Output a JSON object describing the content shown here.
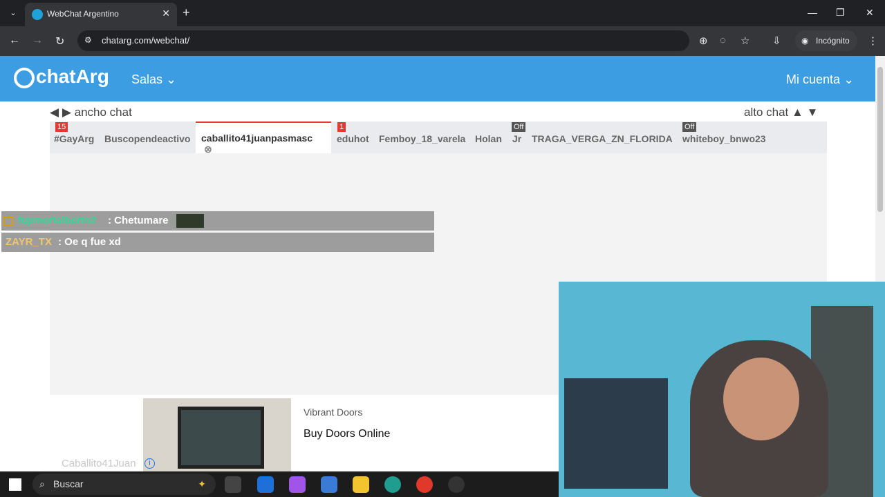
{
  "browser": {
    "tab_title": "WebChat Argentino",
    "url": "chatarg.com/webchat/",
    "incognito_label": "Incógnito",
    "icons": [
      "tab-list-icon",
      "close-icon",
      "new-tab-icon",
      "minimize-icon",
      "maximize-icon",
      "close-window-icon",
      "back-icon",
      "forward-icon",
      "reload-icon",
      "site-info-icon",
      "zoom-icon",
      "eye-off-icon",
      "star-icon",
      "download-icon",
      "incognito-icon",
      "menu-icon"
    ]
  },
  "site": {
    "logo": "chatArg",
    "menu_salas": "Salas",
    "menu_account": "Mi cuenta",
    "ancho_label": "ancho chat",
    "alto_label": "alto chat"
  },
  "rooms": [
    {
      "label": "#GayArg",
      "badge": "15"
    },
    {
      "label": "Buscopendeactivo"
    },
    {
      "label": "caballito41juanpasmasc",
      "active": true
    },
    {
      "label": "eduhot",
      "badge": "1"
    },
    {
      "label": "Femboy_18_varela"
    },
    {
      "label": "Holan"
    },
    {
      "label": "Jr",
      "status": "Off"
    },
    {
      "label": "TRAGA_VERGA_ZN_FLORIDA"
    },
    {
      "label": "whiteboy_bnwo23",
      "status": "Off"
    }
  ],
  "messages": [
    {
      "user": "fujimorialberto2",
      "text": " : Chetumare"
    },
    {
      "user": "ZAYR_TX",
      "text": " : Oe q fue xd"
    }
  ],
  "ad": {
    "brand": "Vibrant Doors",
    "title": "Buy Doors Online"
  },
  "chat_footer": {
    "username": "Caballito41Juan"
  },
  "taskbar": {
    "search_label": "Buscar"
  }
}
